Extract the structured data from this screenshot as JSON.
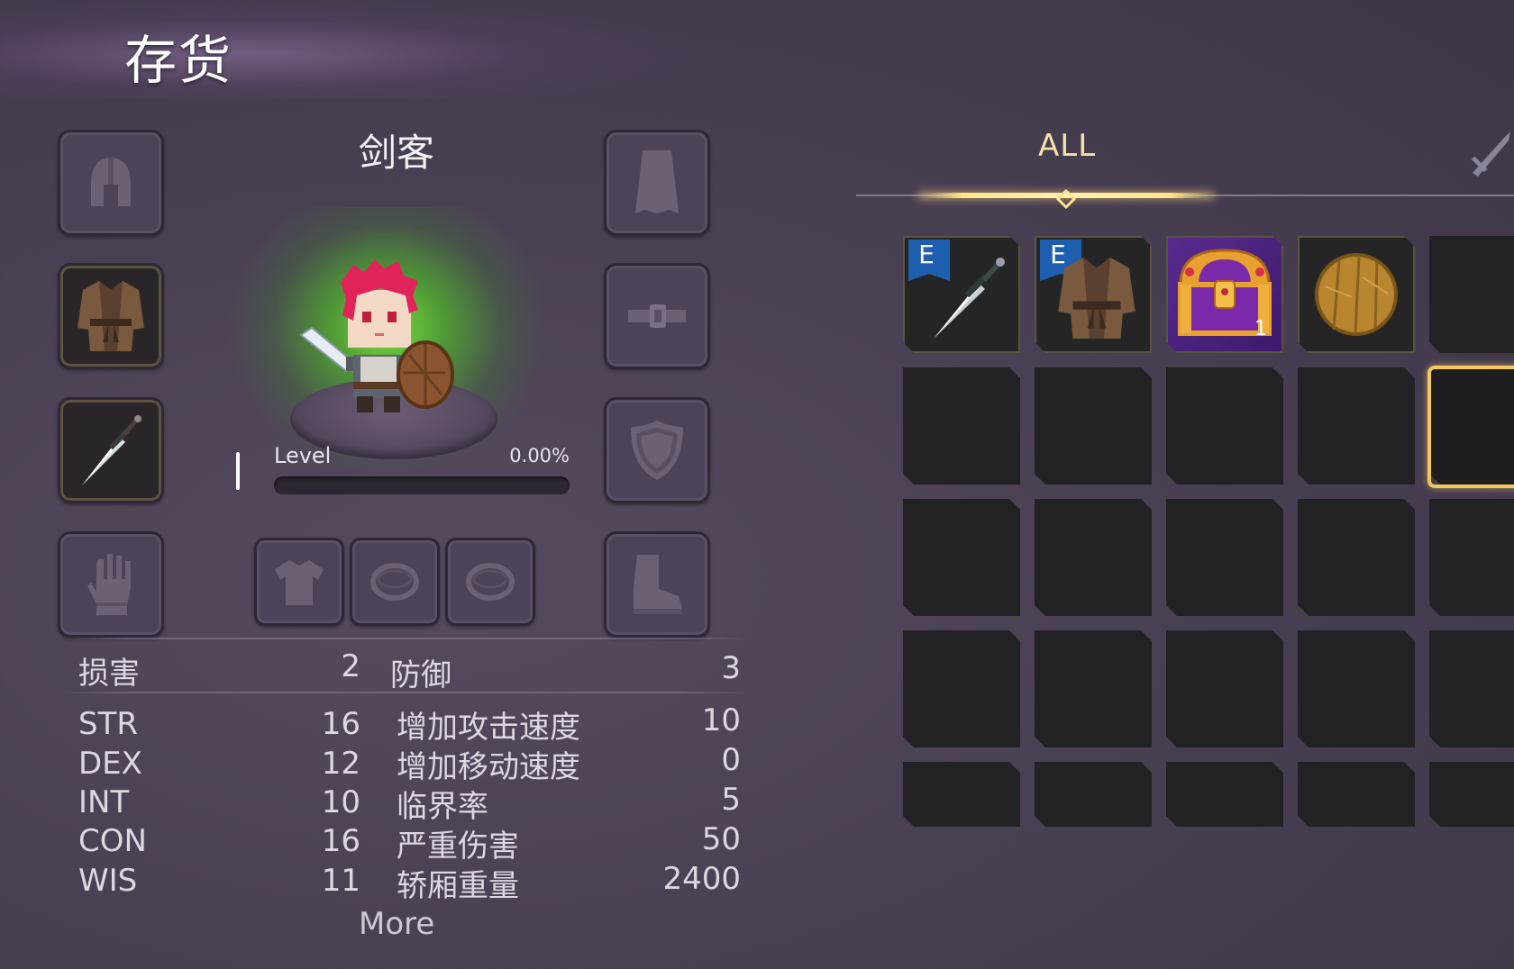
{
  "page": {
    "title": "存货"
  },
  "character": {
    "name": "剑客",
    "level_label": "Level",
    "level_percent_text": "0.00%",
    "level_progress": 0.0
  },
  "equipment_slots": {
    "left": [
      {
        "slot": "helmet",
        "icon": "helmet-icon",
        "equipped": false
      },
      {
        "slot": "armor",
        "icon": "robe-icon",
        "equipped": true
      },
      {
        "slot": "weapon",
        "icon": "dagger-icon",
        "equipped": true
      },
      {
        "slot": "gloves",
        "icon": "glove-icon",
        "equipped": false
      }
    ],
    "right": [
      {
        "slot": "cloak",
        "icon": "cloak-icon",
        "equipped": false
      },
      {
        "slot": "belt",
        "icon": "belt-icon",
        "equipped": false
      },
      {
        "slot": "shield",
        "icon": "shield-icon",
        "equipped": false
      },
      {
        "slot": "boots",
        "icon": "boot-icon",
        "equipped": false
      }
    ],
    "bottom": [
      {
        "slot": "shirt",
        "icon": "shirt-icon",
        "equipped": false
      },
      {
        "slot": "ring-1",
        "icon": "ring-icon",
        "equipped": false
      },
      {
        "slot": "ring-2",
        "icon": "ring-icon",
        "equipped": false
      }
    ]
  },
  "stats": {
    "damage": {
      "label": "损害",
      "value": "2"
    },
    "defense": {
      "label": "防御",
      "value": "3"
    },
    "primary": [
      {
        "label": "STR",
        "value": "16"
      },
      {
        "label": "DEX",
        "value": "12"
      },
      {
        "label": "INT",
        "value": "10"
      },
      {
        "label": "CON",
        "value": "16"
      },
      {
        "label": "WIS",
        "value": "11"
      }
    ],
    "secondary": [
      {
        "label": "增加攻击速度",
        "value": "10"
      },
      {
        "label": "增加移动速度",
        "value": "0"
      },
      {
        "label": "临界率",
        "value": "5"
      },
      {
        "label": "严重伤害",
        "value": "50"
      },
      {
        "label": "轿厢重量",
        "value": "2400"
      }
    ],
    "more_label": "More"
  },
  "inventory": {
    "active_tab": "ALL",
    "next_tab_icon": "sword-icon",
    "items": [
      {
        "icon": "dagger-icon",
        "badge": "E",
        "count": ""
      },
      {
        "icon": "robe-icon",
        "badge": "E",
        "count": ""
      },
      {
        "icon": "treasure-chest-icon",
        "badge": "",
        "count": "1"
      },
      {
        "icon": "wooden-shield-icon",
        "badge": "",
        "count": ""
      }
    ]
  },
  "colors": {
    "background": "#4a4054",
    "gold_accent": "#f2c95a",
    "badge_blue": "#1f5fb0",
    "epic_purple": "#5a2a90",
    "hero_glow": "#7ee03c"
  }
}
